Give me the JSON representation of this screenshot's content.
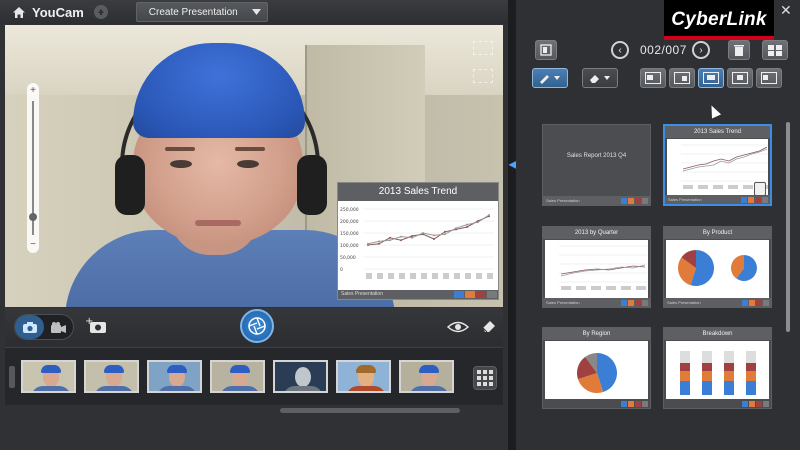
{
  "app": {
    "title": "YouCam",
    "mode_dropdown": "Create Presentation"
  },
  "panel": {
    "brand": "CyberLink",
    "close_glyph": "✕",
    "pager_text": "002/007",
    "prev_glyph": "‹",
    "next_glyph": "›"
  },
  "video_slide": {
    "title": "2013 Sales Trend",
    "footer": "Sales Presentation",
    "y_ticks": [
      "250,000",
      "200,000",
      "150,000",
      "100,000",
      "50,000",
      "0"
    ]
  },
  "slides": [
    {
      "title": "",
      "center_text": "Sales Report 2013 Q4",
      "footer": "Sales Presentation",
      "type": "title"
    },
    {
      "title": "2013 Sales Trend",
      "footer": "Sales Presentation",
      "type": "line",
      "selected": true
    },
    {
      "title": "2013 by Quarter",
      "footer": "Sales Presentation",
      "type": "line2"
    },
    {
      "title": "By Product",
      "footer": "Sales Presentation",
      "type": "pie2"
    },
    {
      "title": "By Region",
      "footer": "",
      "type": "pie"
    },
    {
      "title": "Breakdown",
      "footer": "",
      "type": "stacked"
    }
  ],
  "colors": {
    "accent": "#3b8ee6",
    "swatches": [
      "#3a7fd5",
      "#e07b39",
      "#a04040",
      "#7a7a7a"
    ]
  },
  "icons": {
    "home": "home-icon",
    "camera": "camera-icon",
    "video": "video-icon",
    "add_photo": "add-photo-icon",
    "shutter": "shutter-icon",
    "eye": "eye-effect-icon",
    "eraser": "eraser-icon"
  }
}
